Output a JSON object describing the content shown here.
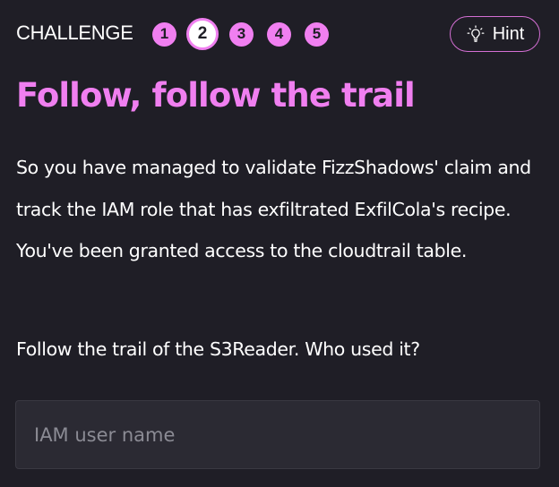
{
  "header": {
    "challenge_label": "CHALLENGE",
    "steps": [
      "1",
      "2",
      "3",
      "4",
      "5"
    ],
    "active_step": "2",
    "hint_label": "Hint",
    "hint_icon": "lightbulb-icon"
  },
  "main": {
    "title": "Follow, follow the trail",
    "paragraph_1": "So you have managed to validate FizzShadows' claim and track the IAM role that has exfiltrated ExfilCola's recipe. You've been granted access to the cloudtrail table.",
    "paragraph_2": "Follow the trail of the S3Reader. Who used it?"
  },
  "answer": {
    "placeholder": "IAM user name",
    "value": ""
  },
  "colors": {
    "background": "#1f1e26",
    "accent": "#f07ff0",
    "input_bg": "#2b2a33",
    "text": "#ffffff"
  }
}
